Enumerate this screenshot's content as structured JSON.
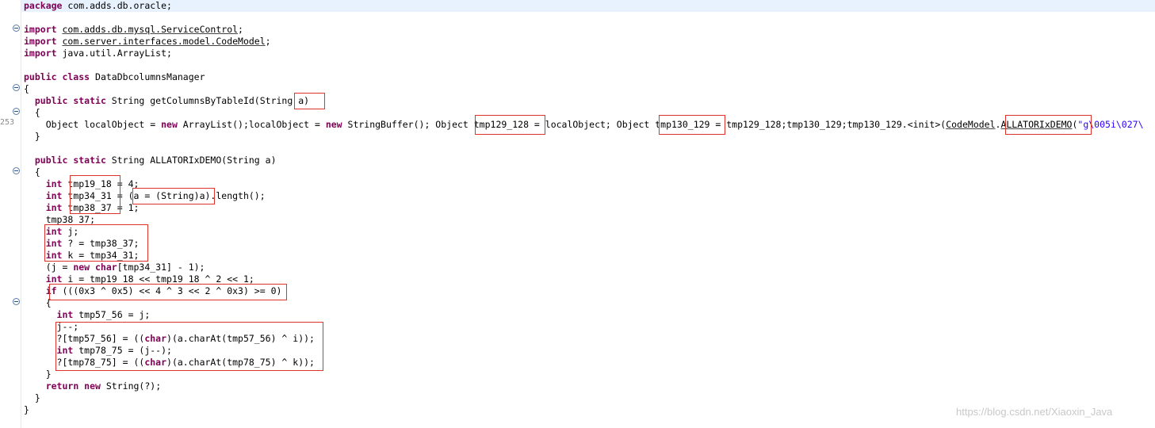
{
  "editor": {
    "gutter": {
      "line_number_label": "253"
    },
    "lines": [
      [
        {
          "t": "package",
          "k": "kw"
        },
        {
          "t": " com.adds.db.oracle;"
        }
      ],
      [],
      [
        {
          "t": "import",
          "k": "kw"
        },
        {
          "t": " "
        },
        {
          "t": "com.adds.db.mysql.ServiceControl",
          "k": "ul"
        },
        {
          "t": ";"
        }
      ],
      [
        {
          "t": "import",
          "k": "kw"
        },
        {
          "t": " "
        },
        {
          "t": "com.server.interfaces.model.CodeModel",
          "k": "ul"
        },
        {
          "t": ";"
        }
      ],
      [
        {
          "t": "import",
          "k": "kw"
        },
        {
          "t": " java.util.ArrayList;"
        }
      ],
      [],
      [
        {
          "t": "public class",
          "k": "kw"
        },
        {
          "t": " DataDbcolumnsManager"
        }
      ],
      [
        {
          "t": "{"
        }
      ],
      [
        {
          "t": "  "
        },
        {
          "t": "public static",
          "k": "kw"
        },
        {
          "t": " String getColumnsByTableId(String a)"
        }
      ],
      [
        {
          "t": "  {"
        }
      ],
      [
        {
          "t": "    Object localObject = "
        },
        {
          "t": "new",
          "k": "kw"
        },
        {
          "t": " ArrayList();localObject = "
        },
        {
          "t": "new",
          "k": "kw"
        },
        {
          "t": " StringBuffer(); Object tmp129_128 = localObject; Object tmp130_129 = tmp129_128;tmp130_129;tmp130_129.<init>("
        },
        {
          "t": "CodeModel",
          "k": "ul"
        },
        {
          "t": "."
        },
        {
          "t": "ALLATORIxDEMO",
          "k": "ul"
        },
        {
          "t": "("
        },
        {
          "t": "\"g\\005i\\027\\",
          "k": "str"
        }
      ],
      [
        {
          "t": "  }"
        }
      ],
      [],
      [
        {
          "t": "  "
        },
        {
          "t": "public static",
          "k": "kw"
        },
        {
          "t": " String ALLATORIxDEMO(String a)"
        }
      ],
      [
        {
          "t": "  {"
        }
      ],
      [
        {
          "t": "    "
        },
        {
          "t": "int",
          "k": "kw"
        },
        {
          "t": " tmp19_18 = 4;"
        }
      ],
      [
        {
          "t": "    "
        },
        {
          "t": "int",
          "k": "kw"
        },
        {
          "t": " tmp34_31 = (a = (String)a).length();"
        }
      ],
      [
        {
          "t": "    "
        },
        {
          "t": "int",
          "k": "kw"
        },
        {
          "t": " tmp38_37 = 1;"
        }
      ],
      [
        {
          "t": "    tmp38_37;"
        }
      ],
      [
        {
          "t": "    "
        },
        {
          "t": "int",
          "k": "kw"
        },
        {
          "t": " j;"
        }
      ],
      [
        {
          "t": "    "
        },
        {
          "t": "int",
          "k": "kw"
        },
        {
          "t": " ? = tmp38_37;"
        }
      ],
      [
        {
          "t": "    "
        },
        {
          "t": "int",
          "k": "kw"
        },
        {
          "t": " k = tmp34_31;"
        }
      ],
      [
        {
          "t": "    (j = "
        },
        {
          "t": "new char",
          "k": "kw"
        },
        {
          "t": "[tmp34_31] - 1);"
        }
      ],
      [
        {
          "t": "    "
        },
        {
          "t": "int",
          "k": "kw"
        },
        {
          "t": " i = tmp19_18 << tmp19_18 ^ 2 << 1;"
        }
      ],
      [
        {
          "t": "    "
        },
        {
          "t": "if",
          "k": "kw"
        },
        {
          "t": " (((0x3 ^ 0x5) << 4 ^ 3 << 2 ^ 0x3) >= 0)"
        }
      ],
      [
        {
          "t": "    {"
        }
      ],
      [
        {
          "t": "      "
        },
        {
          "t": "int",
          "k": "kw"
        },
        {
          "t": " tmp57_56 = j;"
        }
      ],
      [
        {
          "t": "      j--;"
        }
      ],
      [
        {
          "t": "      ?[tmp57_56] = (("
        },
        {
          "t": "char",
          "k": "kw"
        },
        {
          "t": ")(a.charAt(tmp57_56) ^ i));"
        }
      ],
      [
        {
          "t": "      "
        },
        {
          "t": "int",
          "k": "kw"
        },
        {
          "t": " tmp78_75 = (j--);"
        }
      ],
      [
        {
          "t": "      ?[tmp78_75] = (("
        },
        {
          "t": "char",
          "k": "kw"
        },
        {
          "t": ")(a.charAt(tmp78_75) ^ k));"
        }
      ],
      [
        {
          "t": "    }"
        }
      ],
      [
        {
          "t": "    "
        },
        {
          "t": "return new",
          "k": "kw"
        },
        {
          "t": " String(?);"
        }
      ],
      [
        {
          "t": "  }"
        }
      ],
      [
        {
          "t": "}"
        }
      ]
    ]
  },
  "colors": {
    "keyword": "#7f0055",
    "string": "#2a00ff",
    "current_line": "#e8f2fe",
    "annotation_box": "#e0322a"
  },
  "watermark": "https://blog.csdn.net/Xiaoxin_Java"
}
